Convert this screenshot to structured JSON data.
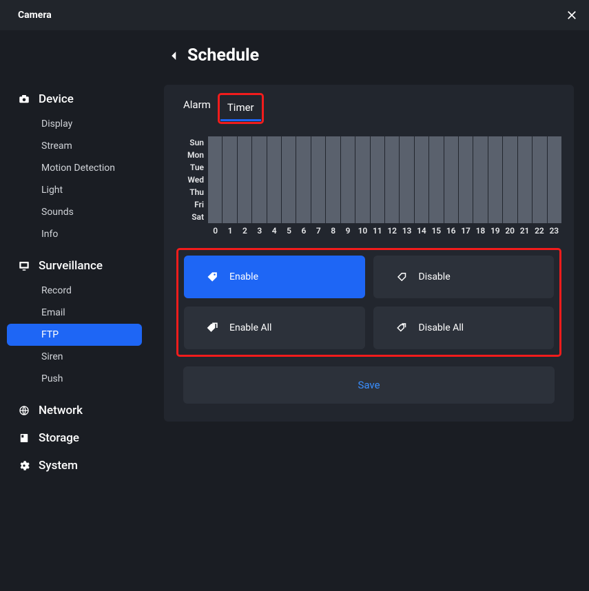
{
  "header": {
    "title": "Camera"
  },
  "page": {
    "title": "Schedule"
  },
  "sidebar": {
    "groups": [
      {
        "label": "Device",
        "items": [
          {
            "label": "Display",
            "active": false
          },
          {
            "label": "Stream",
            "active": false
          },
          {
            "label": "Motion Detection",
            "active": false
          },
          {
            "label": "Light",
            "active": false
          },
          {
            "label": "Sounds",
            "active": false
          },
          {
            "label": "Info",
            "active": false
          }
        ]
      },
      {
        "label": "Surveillance",
        "items": [
          {
            "label": "Record",
            "active": false
          },
          {
            "label": "Email",
            "active": false
          },
          {
            "label": "FTP",
            "active": true
          },
          {
            "label": "Siren",
            "active": false
          },
          {
            "label": "Push",
            "active": false
          }
        ]
      },
      {
        "label": "Network",
        "items": []
      },
      {
        "label": "Storage",
        "items": []
      },
      {
        "label": "System",
        "items": []
      }
    ]
  },
  "tabs": [
    {
      "label": "Alarm",
      "active": false
    },
    {
      "label": "Timer",
      "active": true,
      "highlighted": true
    }
  ],
  "schedule": {
    "days": [
      "Sun",
      "Mon",
      "Tue",
      "Wed",
      "Thu",
      "Fri",
      "Sat"
    ],
    "hours": [
      "0",
      "1",
      "2",
      "3",
      "4",
      "5",
      "6",
      "7",
      "8",
      "9",
      "10",
      "11",
      "12",
      "13",
      "14",
      "15",
      "16",
      "17",
      "18",
      "19",
      "20",
      "21",
      "22",
      "23"
    ]
  },
  "actions": {
    "enable": "Enable",
    "disable": "Disable",
    "enable_all": "Enable All",
    "disable_all": "Disable All",
    "save": "Save"
  },
  "icons": {
    "device": "camera",
    "surveillance": "monitor",
    "network": "globe",
    "storage": "disk",
    "system": "gear"
  },
  "colors": {
    "accent": "#1e66f5",
    "highlight_border": "#f21c1c",
    "panel": "#22262e",
    "cell": "#5a616d"
  }
}
